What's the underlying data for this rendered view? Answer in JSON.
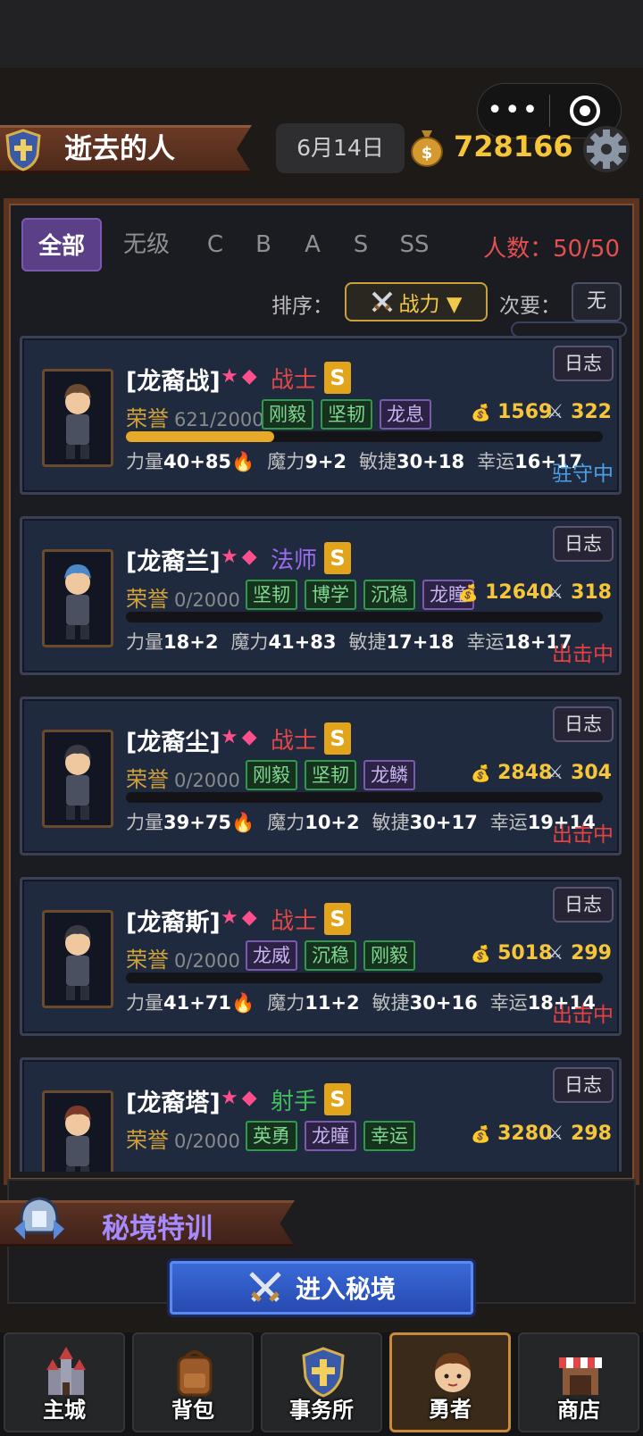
{
  "capsule": {
    "more_glyph": "•••"
  },
  "header": {
    "title": "逝去的人",
    "date": "6月14日",
    "gold": "728166"
  },
  "filter": {
    "tabs": [
      "全部",
      "无级",
      "C",
      "B",
      "A",
      "S",
      "SS"
    ],
    "active_tab": "全部",
    "headcount": "人数：50/50",
    "sort_label": "排序：",
    "sort_value": "战力 ▼",
    "secondary_label": "次要：",
    "secondary_value": "无"
  },
  "heroes": [
    {
      "name": "[龙裔战]",
      "stars": "★◆",
      "class": "战士",
      "class_color": "#e04848",
      "rank": "S",
      "log": "日志",
      "honor_label": "荣誉",
      "honor_value": "621/2000",
      "honor_progress": 0.31,
      "traits": [
        {
          "t": "刚毅",
          "c": "g"
        },
        {
          "t": "坚韧",
          "c": "g"
        },
        {
          "t": "龙息",
          "c": "p"
        }
      ],
      "gold": "1569",
      "power": "322",
      "stats": [
        "力量",
        "40+85🔥",
        "魔力",
        "9+2",
        "敏捷",
        "30+18",
        "幸运",
        "16+17"
      ],
      "status": "驻守中",
      "status_color": "#4aa0e8"
    },
    {
      "name": "[龙裔兰]",
      "stars": "★◆",
      "class": "法师",
      "class_color": "#9a6cf0",
      "rank": "S",
      "log": "日志",
      "honor_label": "荣誉",
      "honor_value": "0/2000",
      "honor_progress": 0,
      "traits": [
        {
          "t": "坚韧",
          "c": "g"
        },
        {
          "t": "博学",
          "c": "g"
        },
        {
          "t": "沉稳",
          "c": "g"
        },
        {
          "t": "龙瞳",
          "c": "p"
        }
      ],
      "gold": "12640",
      "power": "318",
      "stats": [
        "力量",
        "18+2",
        "魔力",
        "41+83",
        "敏捷",
        "17+18",
        "幸运",
        "18+17"
      ],
      "status": "出击中",
      "status_color": "#e84040"
    },
    {
      "name": "[龙裔尘]",
      "stars": "★◆",
      "class": "战士",
      "class_color": "#e04848",
      "rank": "S",
      "log": "日志",
      "honor_label": "荣誉",
      "honor_value": "0/2000",
      "honor_progress": 0,
      "traits": [
        {
          "t": "刚毅",
          "c": "g"
        },
        {
          "t": "坚韧",
          "c": "g"
        },
        {
          "t": "龙鳞",
          "c": "p"
        }
      ],
      "gold": "2848",
      "power": "304",
      "stats": [
        "力量",
        "39+75🔥",
        "魔力",
        "10+2",
        "敏捷",
        "30+17",
        "幸运",
        "19+14"
      ],
      "status": "出击中",
      "status_color": "#e84040"
    },
    {
      "name": "[龙裔斯]",
      "stars": "★◆",
      "class": "战士",
      "class_color": "#e04848",
      "rank": "S",
      "log": "日志",
      "honor_label": "荣誉",
      "honor_value": "0/2000",
      "honor_progress": 0,
      "traits": [
        {
          "t": "龙威",
          "c": "p"
        },
        {
          "t": "沉稳",
          "c": "g"
        },
        {
          "t": "刚毅",
          "c": "g"
        }
      ],
      "gold": "5018",
      "power": "299",
      "stats": [
        "力量",
        "41+71🔥",
        "魔力",
        "11+2",
        "敏捷",
        "30+16",
        "幸运",
        "18+14"
      ],
      "status": "出击中",
      "status_color": "#e84040"
    },
    {
      "name": "[龙裔塔]",
      "stars": "★◆",
      "class": "射手",
      "class_color": "#3fbf5a",
      "rank": "S",
      "log": "日志",
      "honor_label": "荣誉",
      "honor_value": "0/2000",
      "honor_progress": 0,
      "traits": [
        {
          "t": "英勇",
          "c": "g"
        },
        {
          "t": "龙瞳",
          "c": "p"
        },
        {
          "t": "幸运",
          "c": "g"
        }
      ],
      "gold": "3280",
      "power": "298",
      "stats": [],
      "status": "",
      "status_color": "#e84040"
    }
  ],
  "realm": {
    "title": "秘境特训",
    "button": "进入秘境"
  },
  "nav": [
    {
      "label": "主城",
      "icon": "castle-icon"
    },
    {
      "label": "背包",
      "icon": "backpack-icon"
    },
    {
      "label": "事务所",
      "icon": "shield-icon"
    },
    {
      "label": "勇者",
      "icon": "hero-face-icon"
    },
    {
      "label": "商店",
      "icon": "shop-icon"
    }
  ],
  "nav_active": "勇者"
}
